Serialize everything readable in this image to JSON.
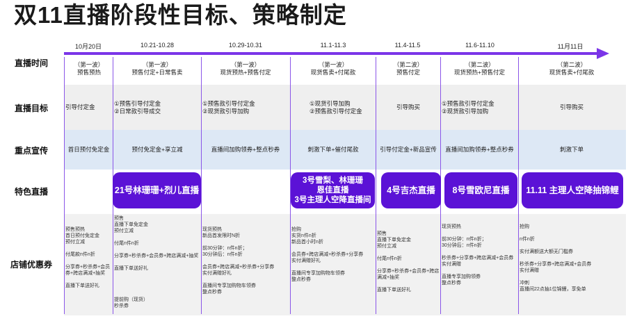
{
  "title": "双11直播阶段性目标、策略制定",
  "row_labels": {
    "time": "直播时间",
    "goal": "直播目标",
    "promo": "重点宣传",
    "special": "特色直播",
    "coupon": "店铺优惠券"
  },
  "dates": [
    "10月20日",
    "10.21-10.28",
    "10.29-10.31",
    "11.1-11.3",
    "11.4-11.5",
    "11.6-11.10",
    "11月11日"
  ],
  "phases": [
    {
      "wave": "（第一波）",
      "desc": "预售预热"
    },
    {
      "wave": "（第一波）",
      "desc": "预售付定+日常售卖"
    },
    {
      "wave": "（第一波）",
      "desc": "现货预热+预售付定"
    },
    {
      "wave": "（第一波）",
      "desc": "现货售卖+付尾款"
    },
    {
      "wave": "（第二波）",
      "desc": "预售付定"
    },
    {
      "wave": "（第二波）",
      "desc": "现货预热+预售付定"
    },
    {
      "wave": "（第二波）",
      "desc": "现货售卖+付尾款"
    }
  ],
  "goals": [
    {
      "l1": "引导付定金",
      "l2": ""
    },
    {
      "l1": "①预售引导付定金",
      "l2": "②日常款引导成交"
    },
    {
      "l1": "①预售款引导付定金",
      "l2": "②现货款引导加购"
    },
    {
      "l1": "①现货引导加购",
      "l2": "②预售款引导付定金"
    },
    {
      "l1": "引导购买",
      "l2": ""
    },
    {
      "l1": "①预售款引导付定金",
      "l2": "②现货款引导加购"
    },
    {
      "l1": "引导购买",
      "l2": ""
    }
  ],
  "promos": [
    "首日预付免定金",
    "预付免定金+享立减",
    "直播间加购领券+整点秒券",
    "刺激下单+催付尾款",
    "引导付定金+新品宣传",
    "直播间加购领券+整点秒券",
    "刺激下单"
  ],
  "special": [
    "21号林珊珊+烈儿直播",
    "3号雪梨、林珊珊\n恩佳直播\n3号主理人空降直播间",
    "4号吉杰直播",
    "8号雪欧尼直播",
    "11.11 主理人空降抽锦鲤"
  ],
  "coupons": [
    "预售预热\n首日预付免定金\n预付立减\n\n付尾款n件n折\n\n分享券+秒杀券+会员券+跨店满减+抽奖\n\n直播下单送好礼",
    "预售\n直播下单免定金\n预付立减\n\n付尾n件n折\n\n分享券+秒杀券+会员券+跨店满减+抽奖\n\n直播下单送好礼\n\n\n\n\n提前购（现货）\n秒杀券",
    "现货预热\n新品首发限时N折\n\n前30分钟：n件n折；\n30分钟后：n件n折\n\n会员券+跨店满减+秒杀券+分享券\n实付满赠好礼\n\n直播间专享加购物车领券\n整点秒券",
    "抢购\n实货n件n折\n新品首小时n折\n\n会员券+跨店满减+秒杀券+分享券\n实付满赠好礼\n\n直播间专享加购物车领券\n整点秒券",
    "预售\n直播下单免定金\n预付立减\n\n付尾n件n折\n\n分享券+秒杀券+会员券+跨店满减+抽奖\n\n直播下单送好礼",
    "现货预热\n\n前30分钟：n件n折；\n30分钟后：n件n折\n\n秒杀券+分享券+跨店满减+会员券\n实付满赠\n\n直播专享加购领券\n整点秒券",
    "抢购\n\nn件n折\n\n实付满额送大额无门槛券\n\n秒杀券+分享券+跨店满减+会员券\n实付满赠\n\n冲刺\n直播间22点抽1位锦鲤，享免单"
  ]
}
